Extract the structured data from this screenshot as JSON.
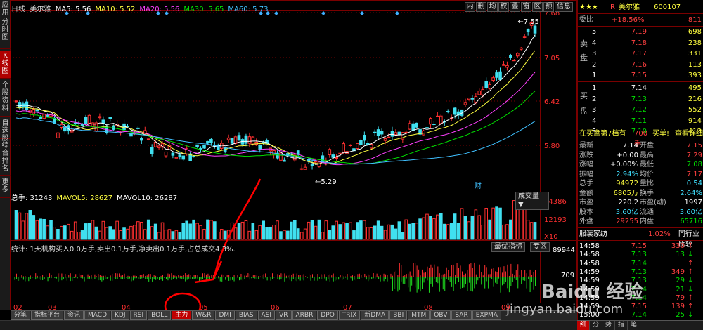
{
  "left_nav": [
    {
      "label": "应用"
    },
    {
      "label": "分时图"
    },
    {
      "label": "K线图",
      "active": true
    },
    {
      "label": "个股资料"
    },
    {
      "label": "自选股"
    },
    {
      "label": "综合排名"
    },
    {
      "label": "更多"
    }
  ],
  "kline": {
    "period": "日线",
    "stock": "美尔雅",
    "ma_legend": [
      {
        "label": "MA5: 5.56",
        "color": "#ffffff"
      },
      {
        "label": "MA10: 5.52",
        "color": "#ffff40"
      },
      {
        "label": "MA20: 5.56",
        "color": "#ff40ff"
      },
      {
        "label": "MA30: 5.65",
        "color": "#00e000"
      },
      {
        "label": "MA60: 5.73",
        "color": "#40c0ff"
      }
    ],
    "price_ticks": [
      "7.68",
      "7.05",
      "6.42",
      "5.80"
    ],
    "high_label": "7.55",
    "low_label": "5.29",
    "fin_marker": "财",
    "tool_buttons": [
      "内",
      "删",
      "均",
      "权",
      "叠",
      "窗",
      "区",
      "预",
      "信息"
    ]
  },
  "volume": {
    "legend": [
      {
        "label": "总手: 31243",
        "color": "#ffffff"
      },
      {
        "label": "MAVOL5: 28627",
        "color": "#ffff40"
      },
      {
        "label": "MAVOL10: 26287",
        "color": "#ffffff"
      }
    ],
    "dropdown": "成交量",
    "ticks": [
      "24386",
      "12193",
      "X10"
    ]
  },
  "indicator": {
    "stats": "统计: 1天机构买入0.0万手,卖出0.1万手,净卖出0.1万手,占总成交4.3%.",
    "buttons": [
      "最优指标",
      "专区"
    ],
    "tick_top": "89944",
    "tick_mid": "709"
  },
  "x_axis": [
    "02",
    "03",
    "04",
    "05",
    "06",
    "07",
    "08",
    "09"
  ],
  "bottom_tabs": [
    {
      "label": "分笔"
    },
    {
      "label": "指标平台"
    },
    {
      "label": "资讯"
    },
    {
      "label": "MACD"
    },
    {
      "label": "KDJ"
    },
    {
      "label": "RSI"
    },
    {
      "label": "BOLL"
    },
    {
      "label": "主力",
      "active": true
    },
    {
      "label": "W&R"
    },
    {
      "label": "DMI"
    },
    {
      "label": "BIAS"
    },
    {
      "label": "ASI"
    },
    {
      "label": "VR"
    },
    {
      "label": "ARBR"
    },
    {
      "label": "DPO"
    },
    {
      "label": "TRIX"
    },
    {
      "label": "新DMA"
    },
    {
      "label": "BBI"
    },
    {
      "label": "MTM"
    },
    {
      "label": "OBV"
    },
    {
      "label": "SAR"
    },
    {
      "label": "EXPMA"
    }
  ],
  "quote": {
    "stars": "★★★",
    "r": "R",
    "name": "美尔雅",
    "code": "600107",
    "weibi_label": "委比",
    "weibi": "+18.56%",
    "weicha": "811",
    "sell_label": [
      "卖",
      "盘"
    ],
    "buy_label": [
      "买",
      "盘"
    ],
    "sells": [
      {
        "n": "5",
        "price": "7.19",
        "vol": "698"
      },
      {
        "n": "4",
        "price": "7.18",
        "vol": "238"
      },
      {
        "n": "3",
        "price": "7.17",
        "vol": "331"
      },
      {
        "n": "2",
        "price": "7.16",
        "vol": "113"
      },
      {
        "n": "1",
        "price": "7.15",
        "vol": "393"
      }
    ],
    "buys": [
      {
        "n": "1",
        "price": "7.14",
        "vol": "495"
      },
      {
        "n": "2",
        "price": "7.13",
        "vol": "216"
      },
      {
        "n": "3",
        "price": "7.12",
        "vol": "552"
      },
      {
        "n": "4",
        "price": "7.11",
        "vol": "914"
      },
      {
        "n": "5",
        "price": "7.10",
        "vol": "413"
      }
    ],
    "info_bar": {
      "left": "在买盘第7档有",
      "mid": "700手",
      "right1": "买单!",
      "right2": "查看详细"
    },
    "stats": [
      {
        "l1": "最新",
        "v1": "7.14",
        "c1": "white",
        "l2": "开盘",
        "v2": "7.15",
        "c2": "red"
      },
      {
        "l1": "涨跌",
        "v1": "+0.00",
        "c1": "white",
        "l2": "最高",
        "v2": "7.29",
        "c2": "red"
      },
      {
        "l1": "涨幅",
        "v1": "+0.00%",
        "c1": "white",
        "l2": "最低",
        "v2": "7.08",
        "c2": "green"
      },
      {
        "l1": "振幅",
        "v1": "2.94%",
        "c1": "cyan",
        "l2": "均价",
        "v2": "7.17",
        "c2": "red"
      },
      {
        "l1": "总手",
        "v1": "94972",
        "c1": "yellow",
        "l2": "量比",
        "v2": "0.54",
        "c2": "cyan"
      },
      {
        "l1": "金额",
        "v1": "6805万",
        "c1": "yellow",
        "l2": "换手",
        "v2": "2.64%",
        "c2": "cyan"
      },
      {
        "l1": "市盈",
        "v1": "220.2",
        "c1": "white",
        "l2": "市盈(动)",
        "v2": "1997",
        "c2": "white"
      },
      {
        "l1": "股本",
        "v1": "3.60亿",
        "c1": "cyan",
        "l2": "流通",
        "v2": "3.60亿",
        "c2": "cyan"
      },
      {
        "l1": "外盘",
        "v1": "29255",
        "c1": "red",
        "l2": "内盘",
        "v2": "65716",
        "c2": "green"
      }
    ],
    "industry": {
      "name": "服装家纺",
      "pct": "1.02%",
      "compare": "同行业比较"
    },
    "ticks": [
      {
        "time": "14:58",
        "price": "7.15",
        "vol": "330",
        "arrow": "up"
      },
      {
        "time": "14:58",
        "price": "7.13",
        "vol": "13",
        "arrow": "down"
      },
      {
        "time": "14:58",
        "price": "7.14",
        "vol": "",
        "arrow": "up"
      },
      {
        "time": "14:59",
        "price": "7.13",
        "vol": "349",
        "arrow": "up"
      },
      {
        "time": "14:59",
        "price": "7.13",
        "vol": "29",
        "arrow": "down"
      },
      {
        "time": "14:59",
        "price": "7.14",
        "vol": "21",
        "arrow": "down"
      },
      {
        "time": "14:59",
        "price": "7.14",
        "vol": "79",
        "arrow": "up"
      },
      {
        "time": "14:59",
        "price": "7.15",
        "vol": "139",
        "arrow": "up"
      },
      {
        "time": "15:00",
        "price": "7.14",
        "vol": "25",
        "arrow": "down"
      }
    ],
    "right_tabs": [
      "细",
      "分",
      "势",
      "指",
      "笔"
    ]
  },
  "watermark": {
    "logo": "Baidu 经验",
    "url": "jingyan.baidu.com"
  },
  "colors": {
    "up": "#ff3030",
    "down": "#40e0f0",
    "grid": "#7a0000",
    "annotation": "#ff0000"
  }
}
